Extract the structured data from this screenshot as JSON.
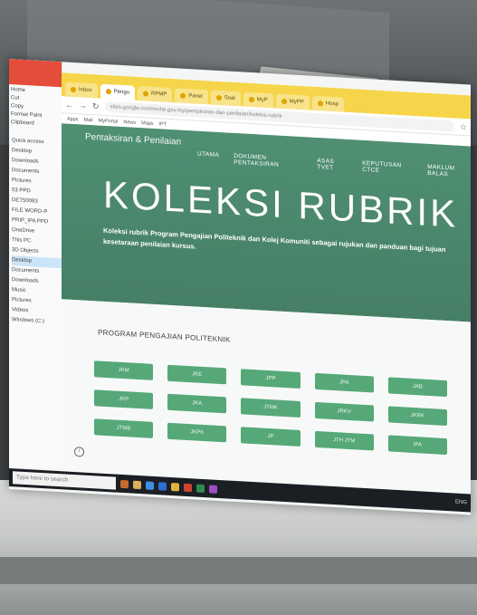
{
  "explorer": {
    "ribbon": [
      "Home",
      "Cut",
      "Copy",
      "Format Paint",
      "Clipboard"
    ],
    "items": [
      "Quick access",
      "Desktop",
      "Downloads",
      "Documents",
      "Pictures",
      "03 PPD",
      "DET50083",
      "FILE WORD-P",
      "PRIP_IPA PPD",
      "OneDrive",
      "This PC",
      "3D Objects",
      "Desktop",
      "Documents",
      "Downloads",
      "Music",
      "Pictures",
      "Videos",
      "Windows (C:)"
    ]
  },
  "browser": {
    "tabs": [
      "Inbox",
      "Pengu",
      "RPMP",
      "Panel",
      "Soal",
      "MyP",
      "MyPP",
      "Hosp"
    ],
    "url": "sites.google.com/mohe.gov.my/pentaksiran-dan-penilaian/koleksi-rubrik",
    "bookmarks": [
      "Apps",
      "Mail",
      "MyPortal",
      "News",
      "Maps",
      "IPT"
    ]
  },
  "site": {
    "brand": "Pentaksiran & Penilaian",
    "nav": [
      "UTAMA",
      "DOKUMEN PENTAKSIRAN",
      "ASAS TVET",
      "KEPUTUSAN CTCE",
      "MAKLUM BALAS"
    ],
    "title": "KOLEKSI RUBRIK",
    "description": "Koleksi rubrik Program Pengajian Politeknik dan Kolej Komuniti sebagai rujukan dan panduan bagi tujuan kesetaraan penilaian kursus.",
    "section_title": "PROGRAM PENGAJIAN POLITEKNIK",
    "buttons": [
      "JKM",
      "JKE",
      "JPP",
      "JPA",
      "JAB",
      "JKP",
      "JKA",
      "JTMK",
      "JRKV",
      "JKRK",
      "JTMB",
      "JKPK",
      "JP",
      "JTH JTM",
      "IPA"
    ]
  },
  "taskbar": {
    "search_placeholder": "Type here to search",
    "tray_text": "ENG"
  }
}
